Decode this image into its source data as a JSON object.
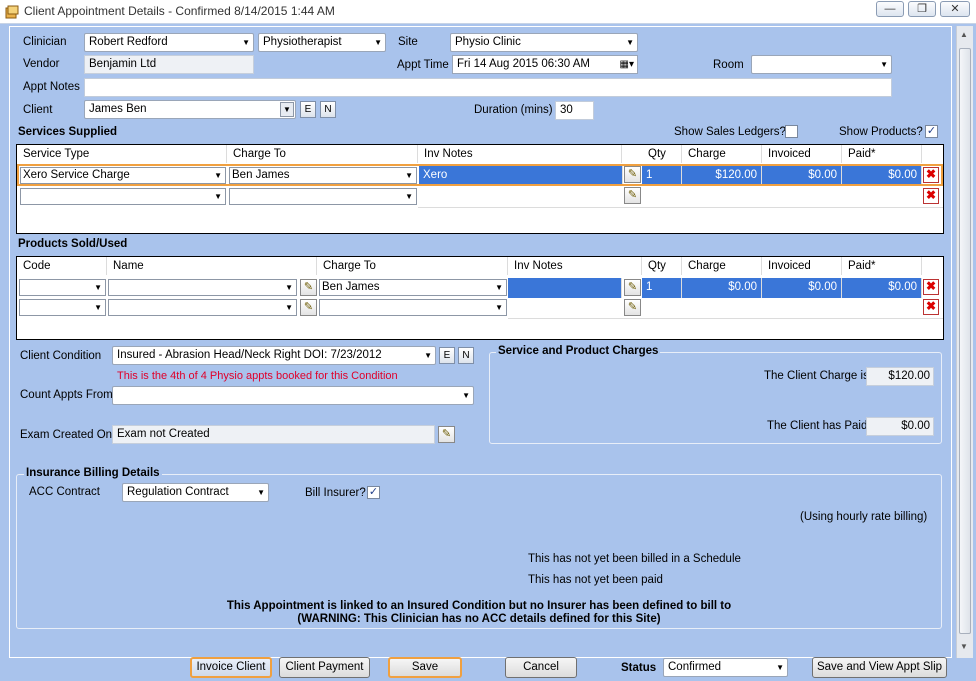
{
  "window": {
    "title": "Client Appointment Details - Confirmed 8/14/2015 1:44 AM"
  },
  "header": {
    "clinician_label": "Clinician",
    "clinician_value": "Robert Redford",
    "role_value": "Physiotherapist",
    "site_label": "Site",
    "site_value": "Physio Clinic",
    "vendor_label": "Vendor",
    "vendor_value": "Benjamin Ltd",
    "appt_time_label": "Appt Time",
    "appt_time_value": "Fri   14 Aug  2015 06:30 AM",
    "room_label": "Room",
    "room_value": "",
    "appt_notes_label": "Appt Notes",
    "appt_notes_value": "",
    "client_label": "Client",
    "client_value": "James Ben",
    "e_btn": "E",
    "n_btn": "N",
    "duration_label": "Duration (mins)",
    "duration_value": "30"
  },
  "services": {
    "title": "Services Supplied",
    "show_sales_ledgers": "Show Sales Ledgers?",
    "show_products": "Show Products?",
    "show_products_checked": "✓",
    "columns": [
      "Service Type",
      "Charge To",
      "Inv Notes",
      "Qty",
      "Charge",
      "Invoiced",
      "Paid*"
    ],
    "rows": [
      {
        "service_type": "Xero Service Charge",
        "charge_to": "Ben James",
        "inv_notes": "Xero",
        "qty": "1",
        "charge": "$120.00",
        "invoiced": "$0.00",
        "paid": "$0.00"
      }
    ]
  },
  "products": {
    "title": "Products Sold/Used",
    "columns": [
      "Code",
      "Name",
      "Charge To",
      "Inv Notes",
      "Qty",
      "Charge",
      "Invoiced",
      "Paid*"
    ],
    "rows": [
      {
        "code": "",
        "name": "",
        "charge_to": "Ben James",
        "inv_notes": "",
        "qty": "1",
        "charge": "$0.00",
        "invoiced": "$0.00",
        "paid": "$0.00"
      }
    ]
  },
  "condition": {
    "label": "Client Condition",
    "value": "Insured -  Abrasion Head/Neck Right DOI: 7/23/2012",
    "e_btn": "E",
    "n_btn": "N",
    "warning": "This is the 4th of 4 Physio appts booked for this Condition",
    "count_label": "Count Appts From",
    "count_value": "",
    "exam_label": "Exam Created On",
    "exam_value": "Exam not Created"
  },
  "charges": {
    "title": "Service and Product Charges",
    "client_charge_label": "The Client Charge is",
    "client_charge_value": "$120.00",
    "client_paid_label": "The Client has Paid",
    "client_paid_value": "$0.00"
  },
  "insurance": {
    "title": "Insurance Billing Details",
    "acc_label": "ACC Contract",
    "acc_value": "Regulation Contract",
    "bill_insurer_label": "Bill Insurer?",
    "bill_insurer_checked": "✓",
    "hourly_note": "(Using hourly rate billing)",
    "not_billed": "This has not yet been billed in a Schedule",
    "not_paid": "This has not yet been paid",
    "warning1": "This Appointment is linked to an Insured Condition but no Insurer has been defined to bill to",
    "warning2": "(WARNING: This Clinician has no ACC details defined for this Site)"
  },
  "footer": {
    "invoice_client": "Invoice Client",
    "client_payment": "Client Payment",
    "save": "Save",
    "cancel": "Cancel",
    "status_label": "Status",
    "status_value": "Confirmed",
    "save_view_slip": "Save and View Appt Slip"
  },
  "colors": {
    "form_bg": "#a9c3ec",
    "selection": "#3a76d8",
    "warning_red": "#e0002a",
    "focus_orange": "#f0a040"
  }
}
